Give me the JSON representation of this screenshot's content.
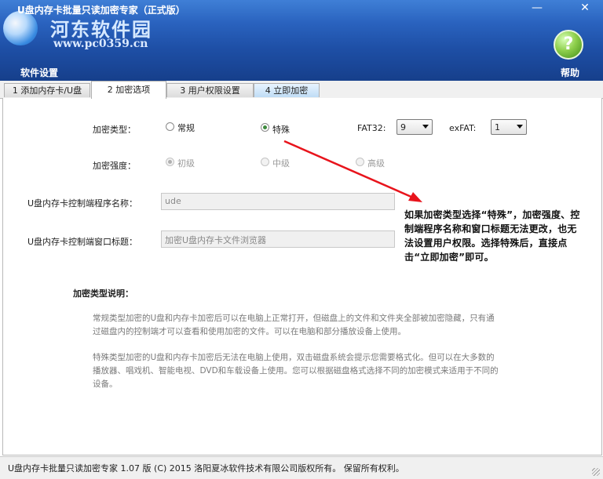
{
  "window": {
    "title": "U盘内存卡批量只读加密专家（正式版）",
    "min_glyph": "—",
    "close_glyph": "✕"
  },
  "header": {
    "watermark_name": "河东软件园",
    "watermark_url": "www.pc0359.cn",
    "settings_label": "软件设置",
    "help_label": "帮助",
    "help_glyph": "?"
  },
  "tabs": [
    {
      "label": "1 添加内存卡/U盘"
    },
    {
      "label": "2 加密选项"
    },
    {
      "label": "3 用户权限设置"
    },
    {
      "label": "4 立即加密"
    }
  ],
  "options": {
    "enc_type_label": "加密类型：",
    "enc_types": [
      "常规",
      "特殊"
    ],
    "enc_type_selected": "特殊",
    "fat32_label": "FAT32:",
    "fat32_value": "9",
    "exfat_label": "exFAT:",
    "exfat_value": "1",
    "strength_label": "加密强度：",
    "strengths": [
      "初级",
      "中级",
      "高级"
    ],
    "prog_name_label": "U盘内存卡控制端程序名称：",
    "prog_name_value": "ude",
    "window_title_label": "U盘内存卡控制端窗口标题：",
    "window_title_value": "加密U盘内存卡文件浏览器"
  },
  "callout_text": "如果加密类型选择“特殊”，加密强度、控制端程序名称和窗口标题无法更改，也无法设置用户权限。选择特殊后，直接点击“立即加密”即可。",
  "description": {
    "title": "加密类型说明：",
    "normal": "常规类型加密的U盘和内存卡加密后可以在电脑上正常打开，但磁盘上的文件和文件夹全部被加密隐藏，只有通过磁盘内的控制端才可以查看和使用加密的文件。可以在电脑和部分播放设备上使用。",
    "special": "特殊类型加密的U盘和内存卡加密后无法在电脑上使用，双击磁盘系统会提示您需要格式化。但可以在大多数的播放器、唱戏机、智能电视、DVD和车载设备上使用。您可以根据磁盘格式选择不同的加密模式来适用于不同的设备。"
  },
  "status": "U盘内存卡批量只读加密专家 1.07 版  (C)  2015 洛阳夏冰软件技术有限公司版权所有。  保留所有权利。",
  "colors": {
    "header_top": "#3f7fd6",
    "header_bottom": "#163f8b",
    "arrow": "#e8141c",
    "help_green": "#6db33f"
  }
}
